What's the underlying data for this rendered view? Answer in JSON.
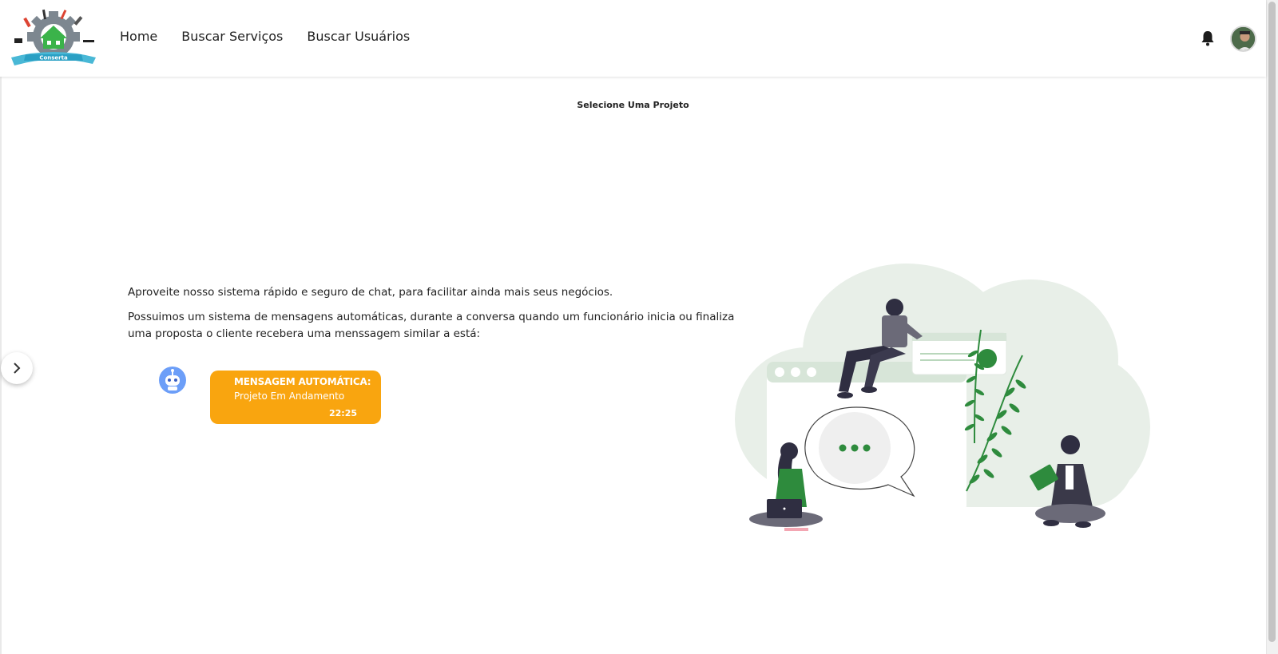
{
  "header": {
    "logo_text": "Conserta",
    "nav": [
      {
        "label": "Home"
      },
      {
        "label": "Buscar Serviços"
      },
      {
        "label": "Buscar Usuários"
      }
    ],
    "icons": {
      "notifications": "bell-icon",
      "profile": "user-avatar"
    }
  },
  "main": {
    "title": "Selecione Uma Projeto",
    "intro_paragraph_1": "Aproveite nosso sistema rápido e seguro de chat, para facilitar ainda mais seus negócios.",
    "intro_paragraph_2": "Possuimos um sistema de mensagens automáticas, durante a conversa quando um funcionário inicia ou finaliza uma proposta o cliente recebera uma menssagem similar a está:",
    "example_message": {
      "title": "MENSAGEM AUTOMÁTICA:",
      "text": "Projeto Em Andamento",
      "time": "22:25"
    }
  },
  "colors": {
    "accent_orange": "#f9a50f",
    "bot_blue": "#6c9ef8",
    "illustration_green": "#2e8b3d",
    "illustration_bg": "#e8efe8"
  }
}
